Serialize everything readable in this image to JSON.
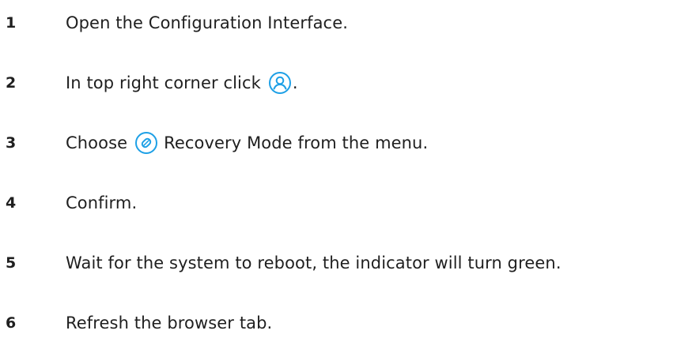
{
  "steps": [
    {
      "number": "1",
      "text": "Open the Configuration Interface."
    },
    {
      "number": "2",
      "text_before": "In top right corner click",
      "icon": "user-profile-icon",
      "text_after": "."
    },
    {
      "number": "3",
      "text_before": "Choose",
      "icon": "recovery-mode-icon",
      "text_after": "Recovery Mode from the menu."
    },
    {
      "number": "4",
      "text": "Confirm."
    },
    {
      "number": "5",
      "text": "Wait for the system to reboot, the indicator will turn green."
    },
    {
      "number": "6",
      "text": "Refresh the browser tab."
    }
  ],
  "colors": {
    "text": "#1f1f1f",
    "icon_accent": "#1ea0e6"
  }
}
